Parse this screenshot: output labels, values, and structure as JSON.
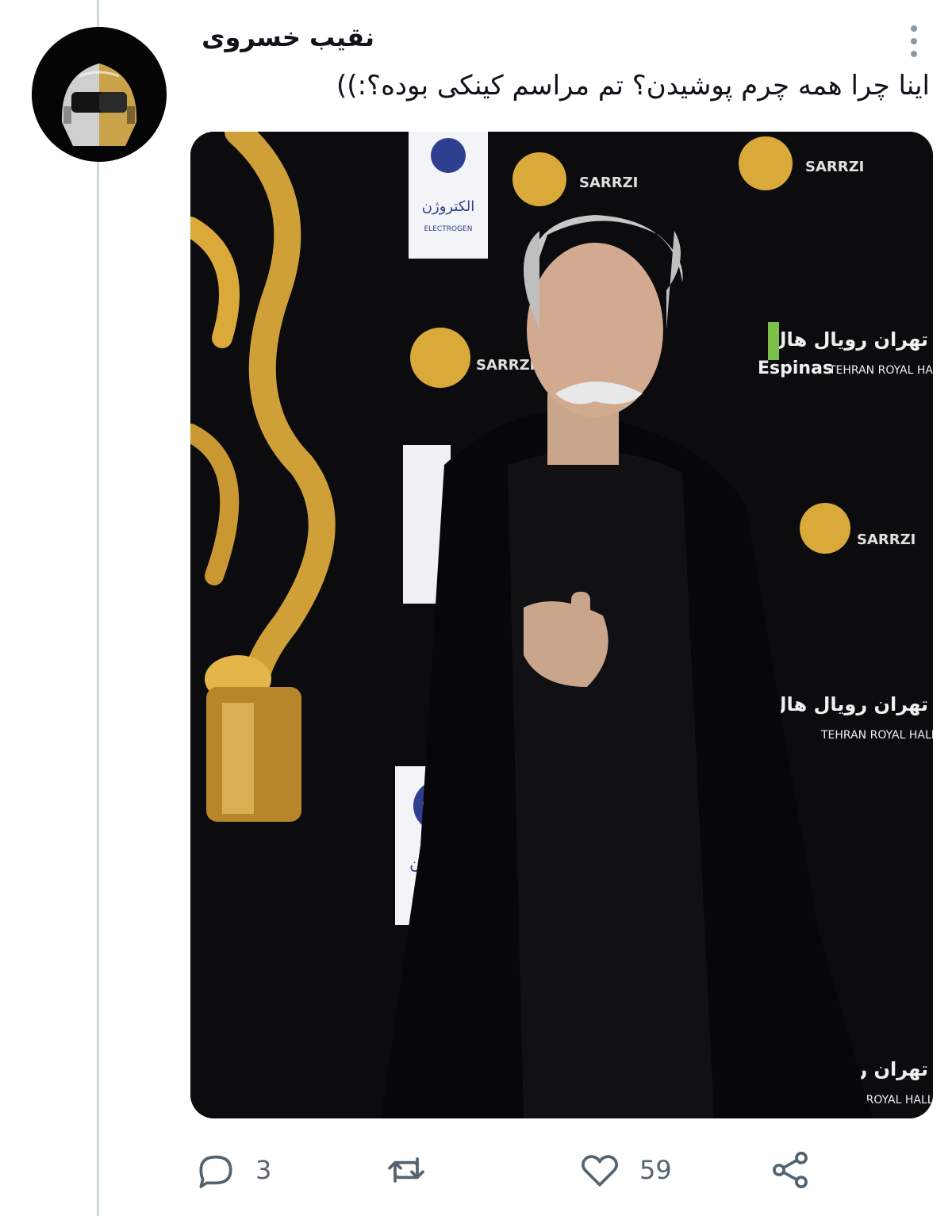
{
  "tweet": {
    "author_name": "نقیب خسروی",
    "text": "اینا چرا همه چرم پوشیدن؟ تم مراسم کینکی بوده؟:))"
  },
  "actions": {
    "reply_count": "3",
    "like_count": "59"
  },
  "icons": {
    "more": "more-vertical-icon",
    "reply": "reply-icon",
    "retweet": "retweet-icon",
    "like": "heart-icon",
    "share": "share-icon"
  },
  "media": {
    "backdrop_labels": {
      "tehran_royal_fa": "تهران رویال هال",
      "tehran_royal_en": "TEHRAN ROYAL HALL",
      "espinas": "Espinas",
      "sarzi": "SARRZI",
      "electrogen_fa": "الکتروژن",
      "electrogen_en": "ELECTROGEN"
    }
  },
  "colors": {
    "text_primary": "#0f1419",
    "text_secondary": "#536471",
    "thread_line": "#cfd9de",
    "gold": "#d9a93a"
  }
}
